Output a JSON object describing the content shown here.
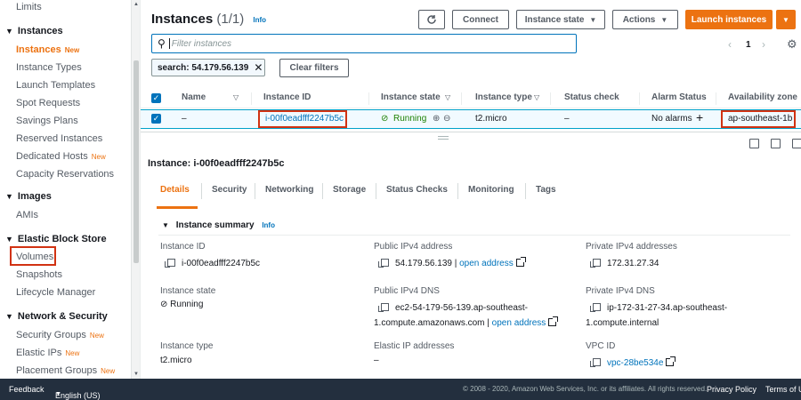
{
  "sidebar": {
    "top_item": "Limits",
    "sections": [
      {
        "label": "Instances"
      },
      {
        "label": "Images"
      },
      {
        "label": "Elastic Block Store"
      },
      {
        "label": "Network & Security"
      }
    ],
    "items": [
      {
        "label": "Instances",
        "badge": "New"
      },
      {
        "label": "Instance Types"
      },
      {
        "label": "Launch Templates"
      },
      {
        "label": "Spot Requests"
      },
      {
        "label": "Savings Plans"
      },
      {
        "label": "Reserved Instances"
      },
      {
        "label": "Dedicated Hosts",
        "badge": "New"
      },
      {
        "label": "Capacity Reservations"
      },
      {
        "label": "AMIs"
      },
      {
        "label": "Volumes"
      },
      {
        "label": "Snapshots"
      },
      {
        "label": "Lifecycle Manager"
      },
      {
        "label": "Security Groups",
        "badge": "New"
      },
      {
        "label": "Elastic IPs",
        "badge": "New"
      },
      {
        "label": "Placement Groups",
        "badge": "New"
      }
    ]
  },
  "header": {
    "title": "Instances",
    "count": "(1/1)",
    "info": "Info",
    "refresh_icon": "refresh-icon",
    "connect": "Connect",
    "instance_state": "Instance state",
    "actions": "Actions",
    "launch": "Launch instances"
  },
  "search": {
    "placeholder": "Filter instances",
    "chip": "search: 54.179.56.139",
    "clear": "Clear filters"
  },
  "pagination": {
    "page": "1"
  },
  "table": {
    "columns": [
      "Name",
      "Instance ID",
      "Instance state",
      "Instance type",
      "Status check",
      "Alarm Status",
      "Availability zone"
    ],
    "row": {
      "name": "–",
      "instance_id": "i-00f0eadfff2247b5c",
      "state": "Running",
      "type": "t2.micro",
      "status_check": "–",
      "alarm": "No alarms",
      "az": "ap-southeast-1b"
    }
  },
  "detail": {
    "title": "Instance: i-00f0eadfff2247b5c",
    "tabs": [
      "Details",
      "Security",
      "Networking",
      "Storage",
      "Status Checks",
      "Monitoring",
      "Tags"
    ],
    "summary_title": "Instance summary",
    "summary_info": "Info",
    "fields": {
      "instance_id_label": "Instance ID",
      "instance_id_value": "i-00f0eadfff2247b5c",
      "public_ipv4_label": "Public IPv4 address",
      "public_ipv4_value": "54.179.56.139",
      "open_address": "open address",
      "private_ipv4_label": "Private IPv4 addresses",
      "private_ipv4_value": "172.31.27.34",
      "state_label": "Instance state",
      "state_value": "Running",
      "public_dns_label": "Public IPv4 DNS",
      "public_dns_value_1": "ec2-54-179-56-139.ap-southeast-",
      "public_dns_value_2": "1.compute.amazonaws.com",
      "private_dns_label": "Private IPv4 DNS",
      "private_dns_value_1": "ip-172-31-27-34.ap-southeast-",
      "private_dns_value_2": "1.compute.internal",
      "type_label": "Instance type",
      "type_value": "t2.micro",
      "eip_label": "Elastic IP addresses",
      "eip_value": "–",
      "vpc_label": "VPC ID",
      "vpc_value": "vpc-28be534e"
    }
  },
  "footer": {
    "feedback": "Feedback",
    "language": "English (US)",
    "copyright": "© 2008 - 2020, Amazon Web Services, Inc. or its affiliates. All rights reserved.",
    "privacy": "Privacy Policy",
    "terms": "Terms of Us"
  },
  "colors": {
    "accent": "#ec7211",
    "link": "#0073bb",
    "highlight": "#d13212",
    "footer": "#232f3e"
  }
}
